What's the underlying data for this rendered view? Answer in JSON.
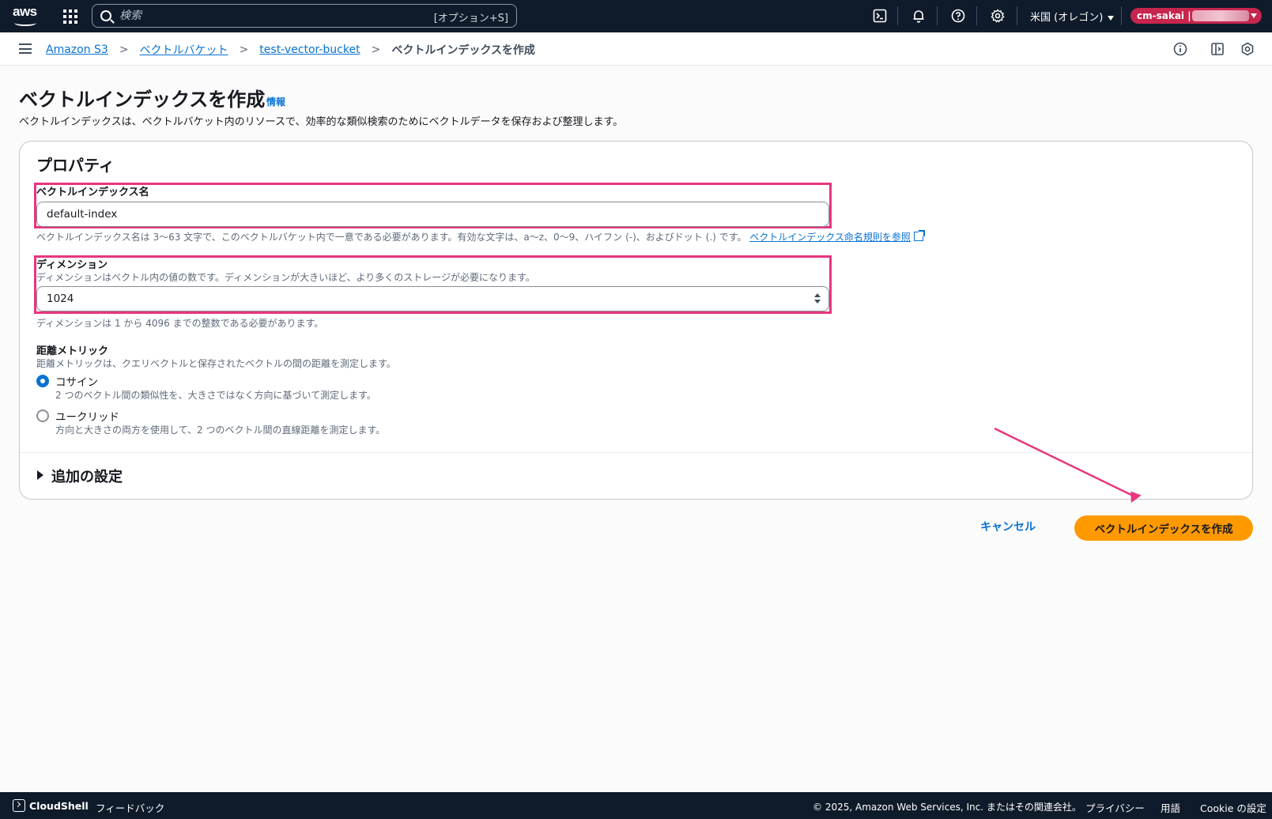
{
  "nav": {
    "logo_text": "aws",
    "search_placeholder": "検索",
    "search_shortcut": "[オプション+S]",
    "region": "米国 (オレゴン)",
    "account": "cm-sakai |"
  },
  "breadcrumb": {
    "items": [
      "Amazon S3",
      "ベクトルバケット",
      "test-vector-bucket"
    ],
    "current": "ベクトルインデックスを作成",
    "separator": ">"
  },
  "header": {
    "title": "ベクトルインデックスを作成",
    "info": "情報",
    "description": "ベクトルインデックスは、ベクトルバケット内のリソースで、効率的な類似検索のためにベクトルデータを保存および整理します。"
  },
  "properties": {
    "title": "プロパティ",
    "index_name": {
      "label": "ベクトルインデックス名",
      "value": "default-index",
      "hint": "ベクトルインデックス名は 3〜63 文字で、このベクトルバケット内で一意である必要があります。有効な文字は、a〜z、0〜9、ハイフン (-)、およびドット (.) です。",
      "link": "ベクトルインデックス命名規則を参照"
    },
    "dimension": {
      "label": "ディメンション",
      "description": "ディメンションはベクトル内の値の数です。ディメンションが大きいほど、より多くのストレージが必要になります。",
      "value": "1024",
      "hint": "ディメンションは 1 から 4096 までの整数である必要があります。"
    },
    "distance_metric": {
      "label": "距離メトリック",
      "description": "距離メトリックは、クエリベクトルと保存されたベクトルの間の距離を測定します。",
      "options": [
        {
          "label": "コサイン",
          "description": "2 つのベクトル間の類似性を、大きさではなく方向に基づいて測定します。",
          "selected": true
        },
        {
          "label": "ユークリッド",
          "description": "方向と大きさの両方を使用して、2 つのベクトル間の直線距離を測定します。",
          "selected": false
        }
      ]
    },
    "additional": "追加の設定"
  },
  "actions": {
    "cancel": "キャンセル",
    "create": "ベクトルインデックスを作成"
  },
  "footer": {
    "cloudshell": "CloudShell",
    "feedback": "フィードバック",
    "copyright": "© 2025, Amazon Web Services, Inc. またはその関連会社。",
    "privacy": "プライバシー",
    "terms": "用語",
    "cookie": "Cookie の設定"
  },
  "colors": {
    "nav_bg": "#0f1b2a",
    "link": "#0972d3",
    "primary": "#ff9900",
    "highlight": "#e8357f",
    "account_badge": "#c7254e"
  }
}
